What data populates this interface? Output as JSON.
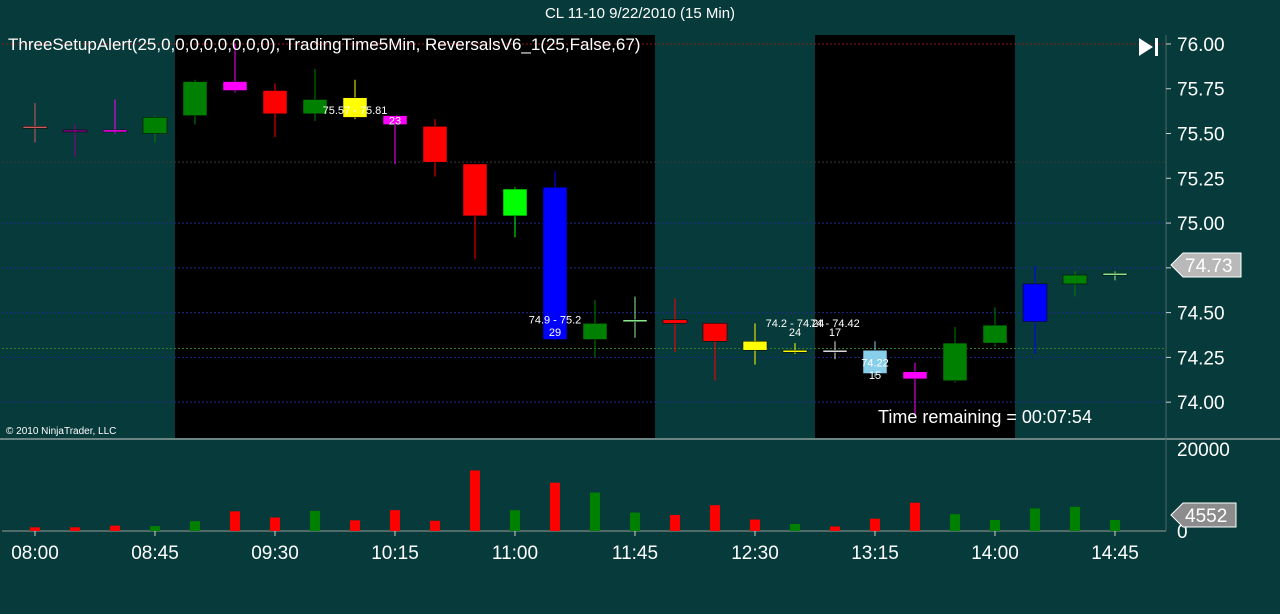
{
  "window_title": "CL 11-10  9/22/2010 (15 Min)",
  "chart_data": {
    "type": "candlestick",
    "indicators_label": "ThreeSetupAlert(25,0,0,0,0,0,0,0,0), TradingTime5Min, ReversalsV6_1(25,False,67)",
    "copyright": "© 2010 NinjaTrader, LLC",
    "time_remaining": "Time remaining = 00:07:54",
    "last_price_label": "74.73",
    "last_price": 74.73,
    "last_volume_label": "4552",
    "last_volume": 4552,
    "price_axis": {
      "min": 73.8,
      "max": 76.05,
      "ticks": [
        "76.00",
        "75.75",
        "75.50",
        "75.25",
        "75.00",
        "74.75",
        "74.50",
        "74.25",
        "74.00"
      ]
    },
    "volume_axis": {
      "min": 0,
      "max": 22000,
      "ticks": [
        "20000",
        "0"
      ]
    },
    "time_ticks": [
      "08:00",
      "08:45",
      "09:30",
      "10:15",
      "11:00",
      "11:45",
      "12:30",
      "13:15",
      "14:00",
      "14:45"
    ],
    "time_tick_bar_index": [
      0,
      3,
      6,
      9,
      12,
      15,
      18,
      21,
      24,
      27
    ],
    "session_zones": [
      [
        4,
        16
      ],
      [
        20,
        25
      ]
    ],
    "colors": {
      "background": "#073a3a",
      "session": "#000000",
      "up": "#008000",
      "down": "#ff0000",
      "vol_up": "#008000",
      "vol_down": "#ff0000",
      "text": "#ffffff"
    },
    "bars": [
      {
        "open": 75.54,
        "high": 75.67,
        "low": 75.45,
        "close": 75.53,
        "color": "#cd5c5c"
      },
      {
        "open": 75.52,
        "high": 75.55,
        "low": 75.37,
        "close": 75.52,
        "color": "#8b008b"
      },
      {
        "open": 75.51,
        "high": 75.69,
        "low": 75.5,
        "close": 75.52,
        "color": "#ff00ff"
      },
      {
        "open": 75.5,
        "high": 75.6,
        "low": 75.45,
        "close": 75.59,
        "color": "#008000"
      },
      {
        "open": 75.6,
        "high": 75.8,
        "low": 75.55,
        "close": 75.79,
        "color": "#008000"
      },
      {
        "open": 75.79,
        "high": 76.0,
        "low": 75.73,
        "close": 75.74,
        "color": "#ff00ff"
      },
      {
        "open": 75.74,
        "high": 75.78,
        "low": 75.48,
        "close": 75.61,
        "color": "#ff0000"
      },
      {
        "open": 75.61,
        "high": 75.86,
        "low": 75.57,
        "close": 75.69,
        "color": "#008000"
      },
      {
        "open": 75.7,
        "high": 75.8,
        "low": 75.58,
        "close": 75.59,
        "color": "#ffff00"
      },
      {
        "open": 75.6,
        "high": 75.6,
        "low": 75.33,
        "close": 75.55,
        "color": "#ff00ff"
      },
      {
        "open": 75.54,
        "high": 75.58,
        "low": 75.26,
        "close": 75.34,
        "color": "#ff0000"
      },
      {
        "open": 75.33,
        "high": 75.33,
        "low": 74.8,
        "close": 75.04,
        "color": "#ff0000"
      },
      {
        "open": 75.04,
        "high": 75.2,
        "low": 74.92,
        "close": 75.19,
        "color": "#00ff00"
      },
      {
        "open": 75.2,
        "high": 75.29,
        "low": 74.34,
        "close": 74.35,
        "color": "#0000ff"
      },
      {
        "open": 74.35,
        "high": 74.57,
        "low": 74.25,
        "close": 74.44,
        "color": "#008000"
      },
      {
        "open": 74.46,
        "high": 74.59,
        "low": 74.36,
        "close": 74.45,
        "color": "#90ee90"
      },
      {
        "open": 74.46,
        "high": 74.58,
        "low": 74.28,
        "close": 74.44,
        "color": "#ff0000"
      },
      {
        "open": 74.44,
        "high": 74.44,
        "low": 74.12,
        "close": 74.34,
        "color": "#ff0000"
      },
      {
        "open": 74.29,
        "high": 74.44,
        "low": 74.21,
        "close": 74.34,
        "color": "#ffff00"
      },
      {
        "open": 74.29,
        "high": 74.33,
        "low": 74.27,
        "close": 74.28,
        "color": "#ffff00"
      },
      {
        "open": 74.29,
        "high": 74.34,
        "low": 74.24,
        "close": 74.29,
        "color": "#dcdcdc"
      },
      {
        "open": 74.29,
        "high": 74.34,
        "low": 74.14,
        "close": 74.16,
        "color": "#87ceeb"
      },
      {
        "open": 74.17,
        "high": 74.22,
        "low": 73.92,
        "close": 74.13,
        "color": "#ff00ff"
      },
      {
        "open": 74.12,
        "high": 74.42,
        "low": 74.11,
        "close": 74.33,
        "color": "#008000"
      },
      {
        "open": 74.33,
        "high": 74.53,
        "low": 74.31,
        "close": 74.43,
        "color": "#008000"
      },
      {
        "open": 74.45,
        "high": 74.76,
        "low": 74.27,
        "close": 74.66,
        "color": "#0000ff"
      },
      {
        "open": 74.66,
        "high": 74.73,
        "low": 74.59,
        "close": 74.71,
        "color": "#008000"
      },
      {
        "open": 74.71,
        "high": 74.73,
        "low": 74.68,
        "close": 74.72,
        "color": "#90ee90"
      }
    ],
    "volume": [
      {
        "value": 900,
        "up": false
      },
      {
        "value": 900,
        "up": false
      },
      {
        "value": 1300,
        "up": false
      },
      {
        "value": 1200,
        "up": true
      },
      {
        "value": 2400,
        "up": true
      },
      {
        "value": 4800,
        "up": false
      },
      {
        "value": 3300,
        "up": false
      },
      {
        "value": 4900,
        "up": true
      },
      {
        "value": 2600,
        "up": false
      },
      {
        "value": 5100,
        "up": false
      },
      {
        "value": 2500,
        "up": false
      },
      {
        "value": 14800,
        "up": false
      },
      {
        "value": 5100,
        "up": true
      },
      {
        "value": 11800,
        "up": false
      },
      {
        "value": 9400,
        "up": true
      },
      {
        "value": 4500,
        "up": true
      },
      {
        "value": 3900,
        "up": false
      },
      {
        "value": 6300,
        "up": false
      },
      {
        "value": 2800,
        "up": false
      },
      {
        "value": 1700,
        "up": true
      },
      {
        "value": 1100,
        "up": false
      },
      {
        "value": 3000,
        "up": false
      },
      {
        "value": 6900,
        "up": false
      },
      {
        "value": 4100,
        "up": true
      },
      {
        "value": 2700,
        "up": true
      },
      {
        "value": 5500,
        "up": true
      },
      {
        "value": 5900,
        "up": true
      },
      {
        "value": 2700,
        "up": true
      }
    ],
    "annotations": [
      {
        "bar": 8,
        "price": 75.61,
        "text": "75.57 - 75.81"
      },
      {
        "bar": 9,
        "price": 75.55,
        "text": "23"
      },
      {
        "bar": 13,
        "price": 74.44,
        "text": "74.9 - 75.2"
      },
      {
        "bar": 13,
        "price": 74.37,
        "text": "29"
      },
      {
        "bar": 19,
        "price": 74.42,
        "text": "74.2 - 74.24"
      },
      {
        "bar": 19,
        "price": 74.37,
        "text": "24"
      },
      {
        "bar": 20,
        "price": 74.42,
        "text": "74 - 74.42"
      },
      {
        "bar": 20,
        "price": 74.37,
        "text": "17"
      },
      {
        "bar": 21,
        "price": 74.2,
        "text": "74.22"
      },
      {
        "bar": 21,
        "price": 74.13,
        "text": "15"
      }
    ],
    "hlines": [
      {
        "price": 76.0,
        "color": "#8b1a1a",
        "dash": true
      },
      {
        "price": 75.34,
        "color": "#3a3a3a",
        "dash": true
      },
      {
        "price": 75.0,
        "color": "#1e2a8c",
        "dash": true
      },
      {
        "price": 74.75,
        "color": "#1e2a8c",
        "dash": true
      },
      {
        "price": 74.5,
        "color": "#1e2a8c",
        "dash": true
      },
      {
        "price": 74.3,
        "color": "#2e7d2e",
        "dash": true
      },
      {
        "price": 74.25,
        "color": "#1e2a8c",
        "dash": true
      },
      {
        "price": 74.0,
        "color": "#1e2a8c",
        "dash": true
      }
    ]
  }
}
